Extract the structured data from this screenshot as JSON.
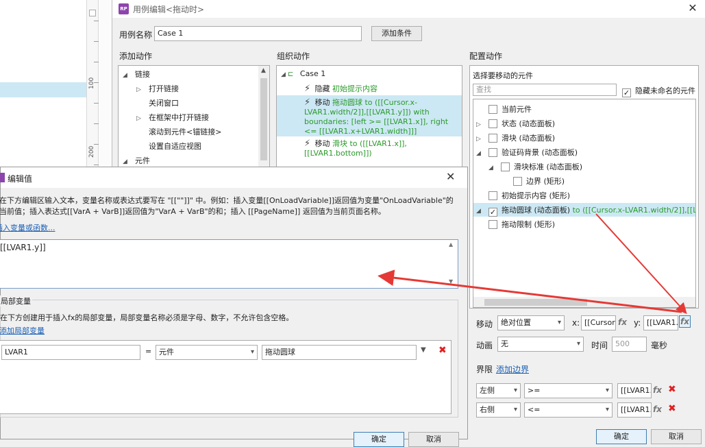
{
  "ruler": {
    "marks": [
      "100",
      "200"
    ]
  },
  "main_dialog": {
    "title": "用例编辑<拖动时>",
    "logo": "RP",
    "close": "✕",
    "case_name_label": "用例名称",
    "case_name_value": "Case 1",
    "add_condition": "添加条件",
    "add_action_header": "添加动作",
    "organize_header": "组织动作",
    "configure_header": "配置动作",
    "add_actions": [
      {
        "label": "链接",
        "level": 0,
        "expander": "◢"
      },
      {
        "label": "打开链接",
        "level": 1,
        "expander": "▷"
      },
      {
        "label": "关闭窗口",
        "level": 1,
        "expander": ""
      },
      {
        "label": "在框架中打开链接",
        "level": 1,
        "expander": "▷"
      },
      {
        "label": "滚动到元件<锚链接>",
        "level": 1,
        "expander": ""
      },
      {
        "label": "设置自适应视图",
        "level": 1,
        "expander": ""
      },
      {
        "label": "元件",
        "level": 0,
        "expander": "◢"
      }
    ],
    "organize": {
      "case_label": "Case 1",
      "actions": [
        {
          "verb": "隐藏",
          "target": "初始提示内容",
          "rest": ""
        },
        {
          "verb": "移动",
          "target": "拖动圆球",
          "rest": " to ([[Cursor.x-LVAR1.width/2]],[[LVAR1.y]]) with boundaries: [left >= [[LVAR1.x]], right <= [[LVAR1.x+LVAR1.width]]]"
        },
        {
          "verb": "移动",
          "target": "滑块",
          "rest": " to ([[LVAR1.x]], [[LVAR1.bottom]])"
        }
      ]
    },
    "configure": {
      "select_label": "选择要移动的元件",
      "search_placeholder": "查找",
      "hide_unnamed_label": "隐藏未命名的元件",
      "widgets": [
        {
          "label": "当前元件",
          "level": 0,
          "expander": "",
          "checked": false
        },
        {
          "label": "状态 (动态面板)",
          "level": 0,
          "expander": "▷",
          "checked": false
        },
        {
          "label": "滑块 (动态面板)",
          "level": 0,
          "expander": "▷",
          "checked": false
        },
        {
          "label": "验证码背景 (动态面板)",
          "level": 0,
          "expander": "◢",
          "checked": false
        },
        {
          "label": "滑块标准 (动态面板)",
          "level": 1,
          "expander": "◢",
          "checked": false
        },
        {
          "label": "边界 (矩形)",
          "level": 2,
          "expander": "",
          "checked": false
        },
        {
          "label": "初始提示内容 (矩形)",
          "level": 0,
          "expander": "",
          "checked": false
        },
        {
          "label": "拖动圆球 (动态面板)",
          "level": 0,
          "expander": "◢",
          "checked": true,
          "suffix": " to ([[Cursor.x-LVAR1.width/2]],[[LVAR"
        },
        {
          "label": "拖动限制 (矩形)",
          "level": 0,
          "expander": "",
          "checked": false
        }
      ],
      "move_label": "移动",
      "move_type": "绝对位置",
      "x_label": "x:",
      "x_value": "[[Cursor",
      "y_label": "y:",
      "y_value": "[[LVAR1.",
      "fx": "fx",
      "animate_label": "动画",
      "animate_value": "无",
      "time_label": "时间",
      "time_value": "500",
      "ms_label": "毫秒",
      "bounds_label": "界限",
      "add_bounds": "添加边界",
      "bounds": [
        {
          "side": "左侧",
          "op": ">=",
          "value": "[[LVAR1."
        },
        {
          "side": "右侧",
          "op": "<=",
          "value": "[[LVAR1."
        }
      ]
    },
    "ok": "确定",
    "cancel": "取消"
  },
  "edit_dialog": {
    "title": "编辑值",
    "close": "✕",
    "help_line1": "在下方编辑区输入文本，变量名称或表达式要写在 \"[[\"\"]]\" 中。例如：插入变量[[OnLoadVariable]]返回值为变量\"OnLoadVariable\"的",
    "help_line2": "当前值；插入表达式[[VarA + VarB]]返回值为\"VarA + VarB\"的和；插入 [[PageName]] 返回值为当前页面名称。",
    "insert_link": "插入变量或函数...",
    "editor_text": "[[LVAR1.y]]",
    "local_vars_header": "局部变量",
    "local_help": "在下方创建用于插入fx的局部变量，局部变量名称必须是字母、数字，不允许包含空格。",
    "add_local": "添加局部变量",
    "var_name": "LVAR1",
    "equals": "=",
    "var_type": "元件",
    "var_target": "拖动圆球",
    "ok": "确定",
    "cancel": "取消"
  },
  "colors": {
    "arrow": "#e53935",
    "selection": "#cce8f4",
    "accent": "#2a9a2a"
  }
}
